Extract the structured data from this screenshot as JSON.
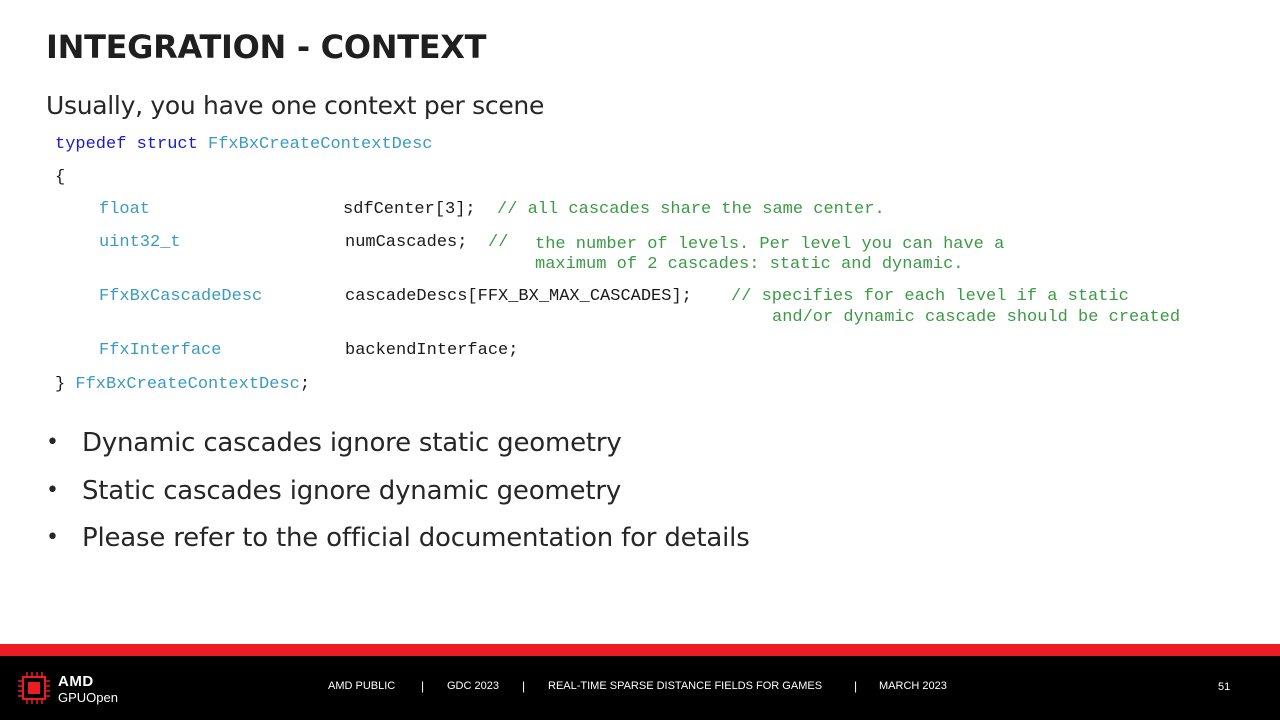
{
  "slide": {
    "title": "INTEGRATION - CONTEXT",
    "subtitle": "Usually, you have one context per scene"
  },
  "code": {
    "line1": {
      "keyword": "typedef struct",
      "type": "FfxBxCreateContextDesc"
    },
    "open_brace": "{",
    "field1": {
      "type": "float",
      "name": "sdfCenter[3];",
      "comment": "// all cascades share the same center."
    },
    "field2": {
      "type": "uint32_t",
      "name": "numCascades;",
      "comment_marker": "//",
      "comment_line1": "the number of levels. Per level you can have a",
      "comment_line2": "maximum of 2 cascades: static and dynamic."
    },
    "field3": {
      "type": "FfxBxCascadeDesc",
      "name": "cascadeDescs[FFX_BX_MAX_CASCADES];",
      "comment_line1": "// specifies for each level if a static",
      "comment_line2": "and/or dynamic cascade should be created"
    },
    "field4": {
      "type": "FfxInterface",
      "name": "backendInterface;"
    },
    "close": {
      "brace": "}",
      "type": "FfxBxCreateContextDesc",
      "semicolon": ";"
    }
  },
  "bullets": [
    "Dynamic cascades ignore static geometry",
    "Static cascades ignore dynamic geometry",
    "Please refer to the official documentation for details"
  ],
  "footer": {
    "logo_line1": "AMD",
    "logo_line2": "GPUOpen",
    "classification": "AMD PUBLIC",
    "event": "GDC 2023",
    "talk_title": "REAL-TIME SPARSE DISTANCE FIELDS FOR GAMES",
    "date": "MARCH 2023",
    "separator": "|",
    "page_number": "51"
  },
  "colors": {
    "keyword": "#1a1ac8",
    "type": "#3a9bbf",
    "comment": "#3c9a46",
    "accent_red": "#ed1c24",
    "footer_bg": "#000000"
  },
  "icons": {
    "logo": "chip-icon"
  }
}
